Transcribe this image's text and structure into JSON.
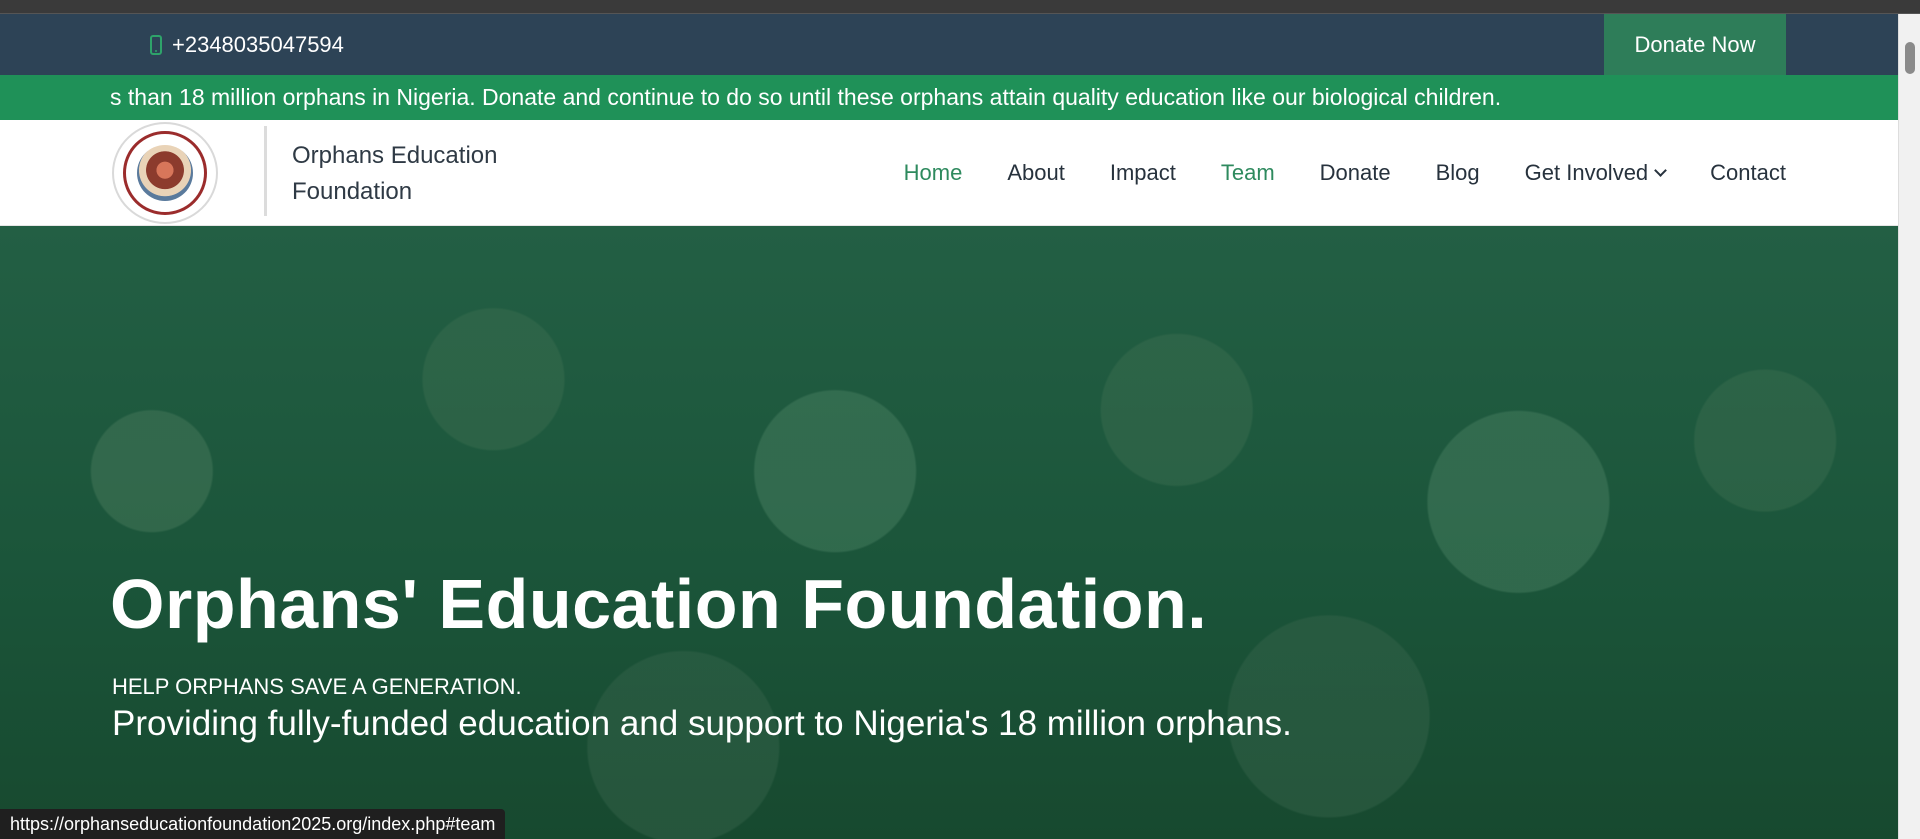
{
  "topbar": {
    "phone_icon": "phone-icon",
    "phone": "+2348035047594",
    "donate_button": "Donate Now",
    "colors": {
      "background": "#2d4356",
      "button": "#2e7d59"
    }
  },
  "ticker": {
    "text": "s than 18 million orphans in Nigeria. Donate and continue to do so until these orphans attain quality education like our biological children.",
    "color": "#1f9158"
  },
  "header": {
    "brand_line1": "Orphans Education",
    "brand_line2": "Foundation",
    "nav": [
      {
        "label": "Home"
      },
      {
        "label": "About"
      },
      {
        "label": "Impact"
      },
      {
        "label": "Team"
      },
      {
        "label": "Donate"
      },
      {
        "label": "Blog"
      },
      {
        "label": "Get Involved",
        "icon": "chevron-down-icon"
      },
      {
        "label": "Contact"
      }
    ],
    "accent": "#2e8a5e"
  },
  "hero": {
    "title": "Orphans' Education Foundation.",
    "kicker": "HELP ORPHANS SAVE A GENERATION.",
    "subtitle": "Providing fully-funded education and support to Nigeria's 18 million orphans."
  },
  "status_bar": {
    "url": "https://orphanseducationfoundation2025.org/index.php#team"
  }
}
